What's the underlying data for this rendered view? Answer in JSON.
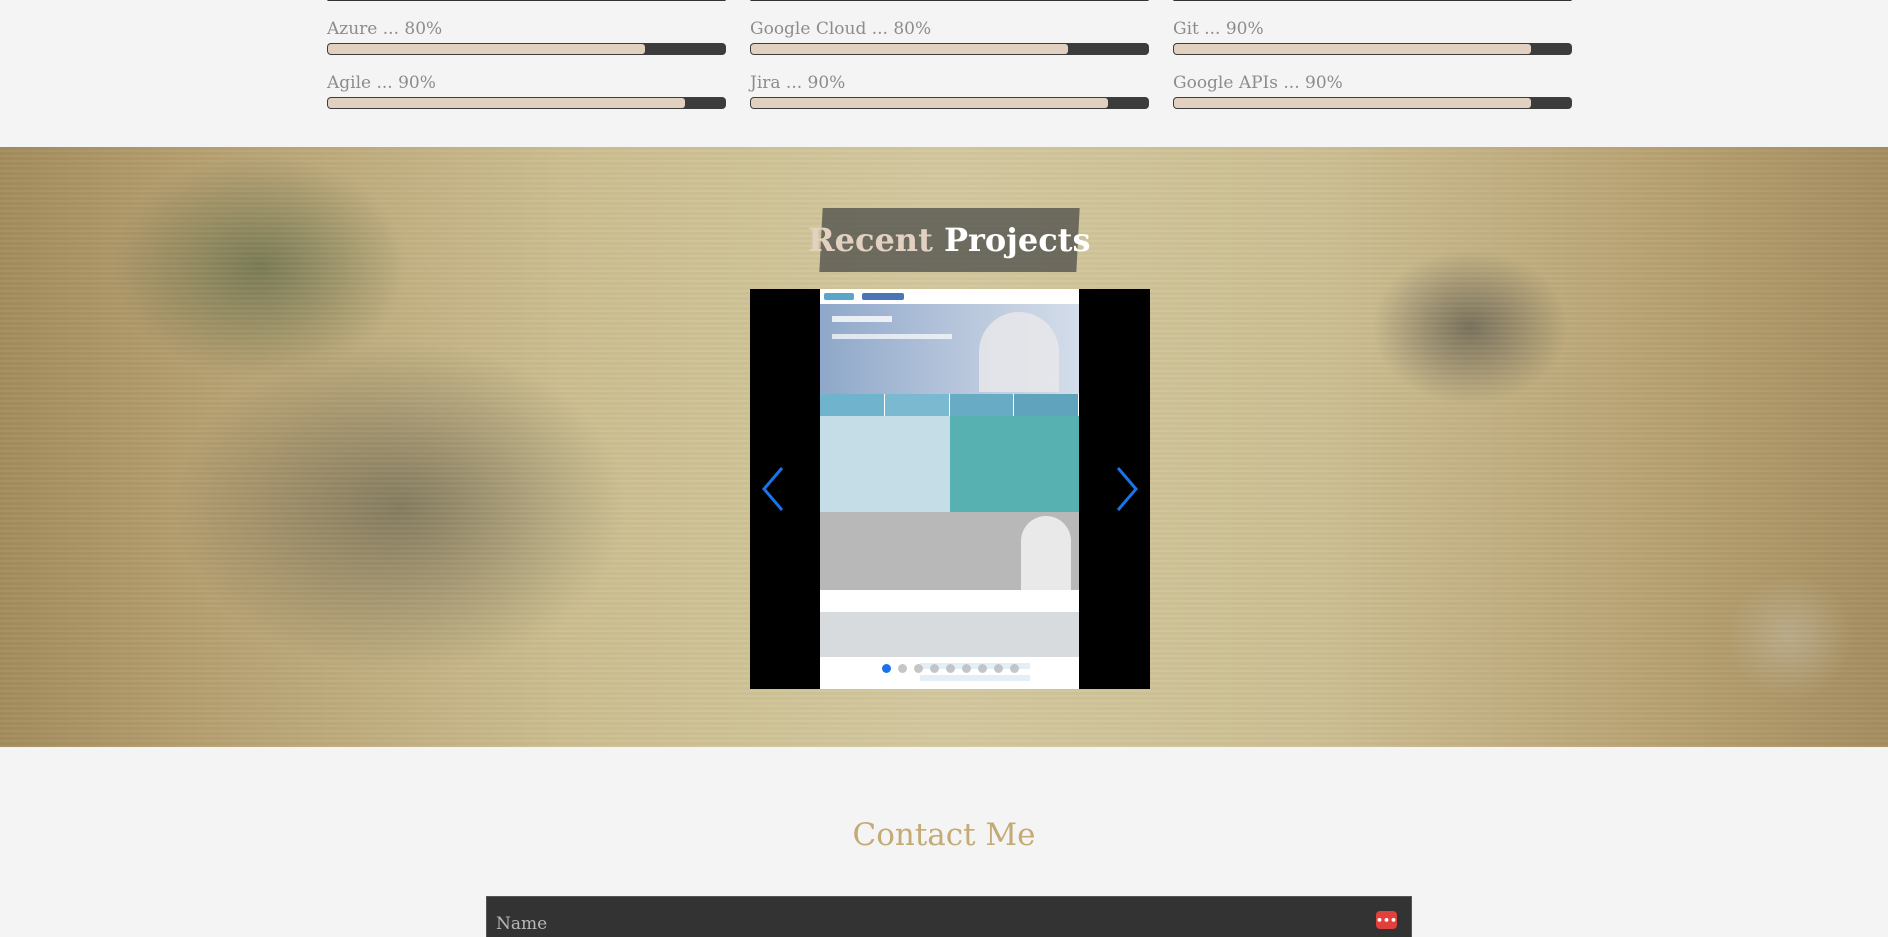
{
  "skills": [
    {
      "label": "Azure ... 80%",
      "level": 0.8
    },
    {
      "label": "Google Cloud ... 80%",
      "level": 0.8
    },
    {
      "label": "Git ... 90%",
      "level": 0.9
    },
    {
      "label": "Agile ... 90%",
      "level": 0.9
    },
    {
      "label": "Jira ... 90%",
      "level": 0.9
    },
    {
      "label": "Google APIs ... 90%",
      "level": 0.9
    }
  ],
  "projects": {
    "title_part1": "Recent",
    "title_part2": "Projects",
    "slide_count": 9,
    "active_slide": 0
  },
  "contact": {
    "title": "Contact Me",
    "name_placeholder": "Name"
  },
  "icons": {
    "prev": "chevron-left-icon",
    "next": "chevron-right-icon",
    "password_manager": "more-dots-icon"
  },
  "colors": {
    "accent": "#c4ab76",
    "carousel_arrow": "#1a73e8",
    "skill_fill": "#e2d1c0",
    "skill_track": "#3c3c3c"
  }
}
